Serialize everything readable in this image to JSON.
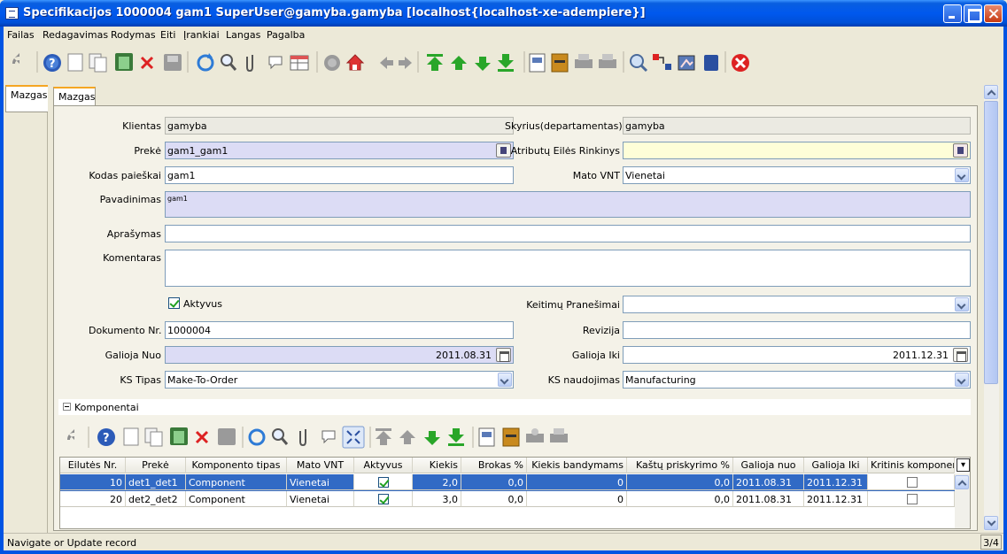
{
  "window": {
    "title": "Specifikacijos  1000004  gam1  SuperUser@gamyba.gamyba [localhost{localhost-xe-adempiere}]"
  },
  "menu": [
    "Failas",
    "Redagavimas",
    "Rodymas",
    "Eiti",
    "Įrankiai",
    "Langas",
    "Pagalba"
  ],
  "tabs": {
    "left": "Mazgas",
    "top": "Mazgas"
  },
  "form": {
    "klientas": {
      "label": "Klientas",
      "value": "gamyba"
    },
    "skyrius": {
      "label": "Skyrius(departamentas)",
      "value": "gamyba"
    },
    "preke": {
      "label": "Prekė",
      "value": "gam1_gam1"
    },
    "atributu": {
      "label": "Atributų Eilės Rinkinys",
      "value": ""
    },
    "kodas": {
      "label": "Kodas paieškai",
      "value": "gam1"
    },
    "mato_vnt": {
      "label": "Mato VNT",
      "value": "Vienetai"
    },
    "pavadinimas": {
      "label": "Pavadinimas",
      "value": "gam1"
    },
    "aprasymas": {
      "label": "Aprašymas",
      "value": ""
    },
    "komentaras": {
      "label": "Komentaras",
      "value": ""
    },
    "aktyvus": {
      "label": "Aktyvus",
      "checked": true
    },
    "keitimu": {
      "label": "Keitimų Pranešimai",
      "value": ""
    },
    "dokumento": {
      "label": "Dokumento Nr.",
      "value": "1000004"
    },
    "revizija": {
      "label": "Revizija",
      "value": ""
    },
    "galioja_nuo": {
      "label": "Galioja Nuo",
      "value": "2011.08.31"
    },
    "galioja_iki": {
      "label": "Galioja Iki",
      "value": "2011.12.31"
    },
    "ks_tipas": {
      "label": "KS Tipas",
      "value": "Make-To-Order"
    },
    "ks_naudojimas": {
      "label": "KS naudojimas",
      "value": "Manufacturing"
    }
  },
  "section": {
    "title": "Komponentai"
  },
  "grid": {
    "columns": [
      "Eilutės Nr.",
      "Prekė",
      "Komponento tipas",
      "Mato VNT",
      "Aktyvus",
      "Kiekis",
      "Brokas %",
      "Kiekis bandymams",
      "Kaštų priskyrimo %",
      "Galioja nuo",
      "Galioja Iki",
      "Kritinis komponen"
    ],
    "rows": [
      {
        "nr": "10",
        "preke": "det1_det1",
        "tipas": "Component",
        "vnt": "Vienetai",
        "aktyvus": true,
        "kiekis": "2,0",
        "brokas": "0,0",
        "bandymams": "0",
        "kastu": "0,0",
        "nuo": "2011.08.31",
        "iki": "2011.12.31",
        "kritinis": false
      },
      {
        "nr": "20",
        "preke": "det2_det2",
        "tipas": "Component",
        "vnt": "Vienetai",
        "aktyvus": true,
        "kiekis": "3,0",
        "brokas": "0,0",
        "bandymams": "0",
        "kastu": "0,0",
        "nuo": "2011.08.31",
        "iki": "2011.12.31",
        "kritinis": false
      }
    ]
  },
  "status": {
    "message": "Navigate or Update record",
    "record": "3/4"
  },
  "colors": {
    "titlebar": "#0058ee",
    "mandatory": "#dcdcf5",
    "selection": "#316ac5",
    "tab_accent": "#f5a623"
  }
}
